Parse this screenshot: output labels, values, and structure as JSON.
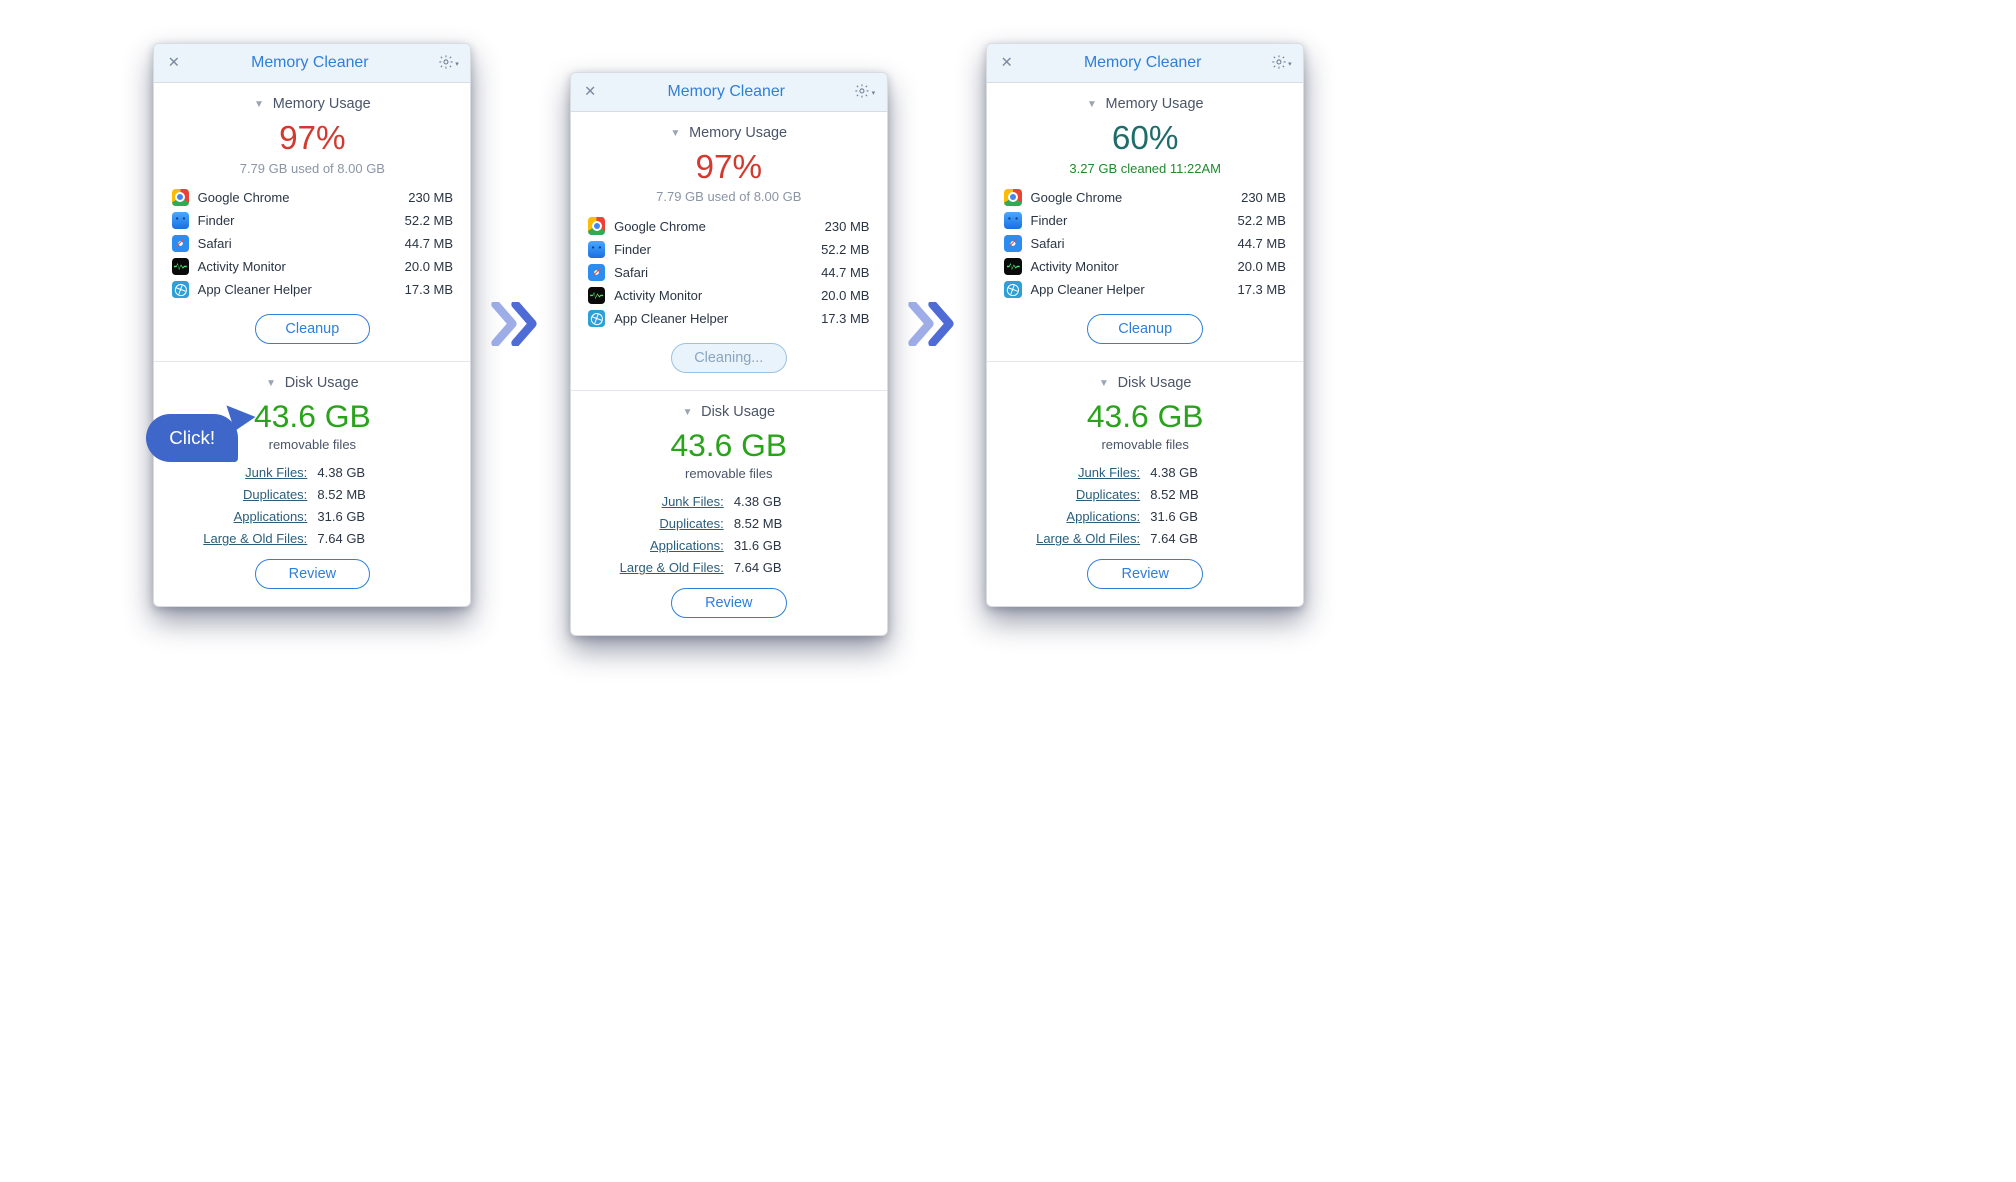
{
  "callout": {
    "text": "Click!"
  },
  "app_title": "Memory Cleaner",
  "sections": {
    "memory_title": "Memory Usage",
    "disk_title": "Disk Usage"
  },
  "apps": [
    {
      "name": "Google Chrome",
      "size": "230 MB"
    },
    {
      "name": "Finder",
      "size": "52.2 MB"
    },
    {
      "name": "Safari",
      "size": "44.7 MB"
    },
    {
      "name": "Activity Monitor",
      "size": "20.0 MB"
    },
    {
      "name": "App Cleaner Helper",
      "size": "17.3 MB"
    }
  ],
  "disk": {
    "size": "43.6 GB",
    "sub": "removable files",
    "items": [
      {
        "label": "Junk Files:",
        "value": "4.38 GB"
      },
      {
        "label": "Duplicates:",
        "value": "8.52 MB"
      },
      {
        "label": "Applications:",
        "value": "31.6 GB"
      },
      {
        "label": "Large & Old Files:",
        "value": "7.64 GB"
      }
    ],
    "review_btn": "Review"
  },
  "panels": [
    {
      "pct": "97%",
      "pct_class": "pct-red",
      "sub": "7.79 GB used of 8.00 GB",
      "sub_class": "sub-gray",
      "btn": "Cleanup",
      "btn_class": ""
    },
    {
      "pct": "97%",
      "pct_class": "pct-red",
      "sub": "7.79 GB used of 8.00 GB",
      "sub_class": "sub-gray",
      "btn": "Cleaning...",
      "btn_class": "cleaning"
    },
    {
      "pct": "60%",
      "pct_class": "pct-teal",
      "sub": "3.27 GB cleaned 11:22AM",
      "sub_class": "sub-green",
      "btn": "Cleanup",
      "btn_class": ""
    }
  ]
}
